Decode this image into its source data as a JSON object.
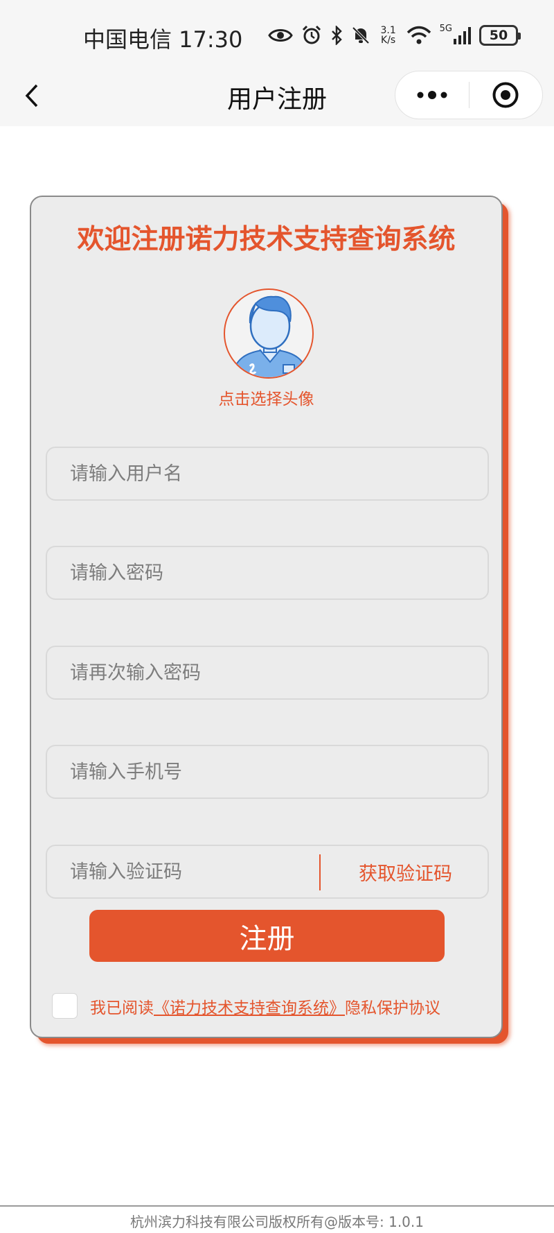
{
  "status_bar": {
    "carrier_time": "中国电信 17:30",
    "net_speed_top": "3.1",
    "net_speed_bottom": "K/s",
    "network": "5G",
    "battery": "50",
    "icons": [
      "eye-icon",
      "alarm-icon",
      "bluetooth-icon",
      "mute-icon",
      "wifi-icon",
      "signal-icon",
      "battery-icon"
    ]
  },
  "nav": {
    "title": "用户注册",
    "icons": [
      "back-arrow-icon",
      "more-icon",
      "close-target-icon"
    ]
  },
  "form": {
    "title": "欢迎注册诺力技术支持查询系统",
    "avatar_label": "点击选择头像",
    "username_placeholder": "请输入用户名",
    "password_placeholder": "请输入密码",
    "password_confirm_placeholder": "请再次输入密码",
    "phone_placeholder": "请输入手机号",
    "code_placeholder": "请输入验证码",
    "get_code_label": "获取验证码",
    "submit_label": "注册",
    "agree_prefix": "我已阅读",
    "agree_link": "《诺力技术支持查询系统》",
    "agree_suffix": "隐私保护协议"
  },
  "footer": {
    "text": "杭州滨力科技有限公司版权所有@版本号: 1.0.1"
  },
  "colors": {
    "accent": "#e4552d",
    "card_bg": "#ececec",
    "bar_bg": "#f6f6f6"
  }
}
